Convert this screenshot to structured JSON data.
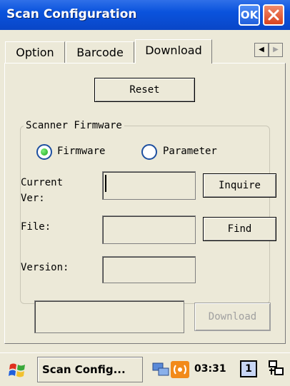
{
  "window": {
    "title": "Scan Configuration",
    "ok_label": "OK"
  },
  "tabs": [
    {
      "label": "Option",
      "selected": false
    },
    {
      "label": "Barcode",
      "selected": false
    },
    {
      "label": "Download",
      "selected": true
    }
  ],
  "tab_scroll": {
    "left": "◀",
    "right": "▶"
  },
  "download": {
    "reset_label": "Reset",
    "group_title": "Scanner Firmware",
    "radio_firmware": "Firmware",
    "radio_parameter": "Parameter",
    "selected_radio": "Firmware",
    "current_ver_label_line1": "Current",
    "current_ver_label_line2": "Ver:",
    "current_ver_value": "",
    "inquire_label": "Inquire",
    "file_label": "File:",
    "file_value": "",
    "find_label": "Find",
    "version_label": "Version:",
    "version_value": "",
    "status_value": "",
    "download_label": "Download"
  },
  "taskbar": {
    "task_label": "Scan Config...",
    "clock": "03:31",
    "input_indicator": "1"
  },
  "colors": {
    "titlebar": "#0a53dd",
    "face": "#ece9d8",
    "radio_on": "#1aa81a"
  }
}
